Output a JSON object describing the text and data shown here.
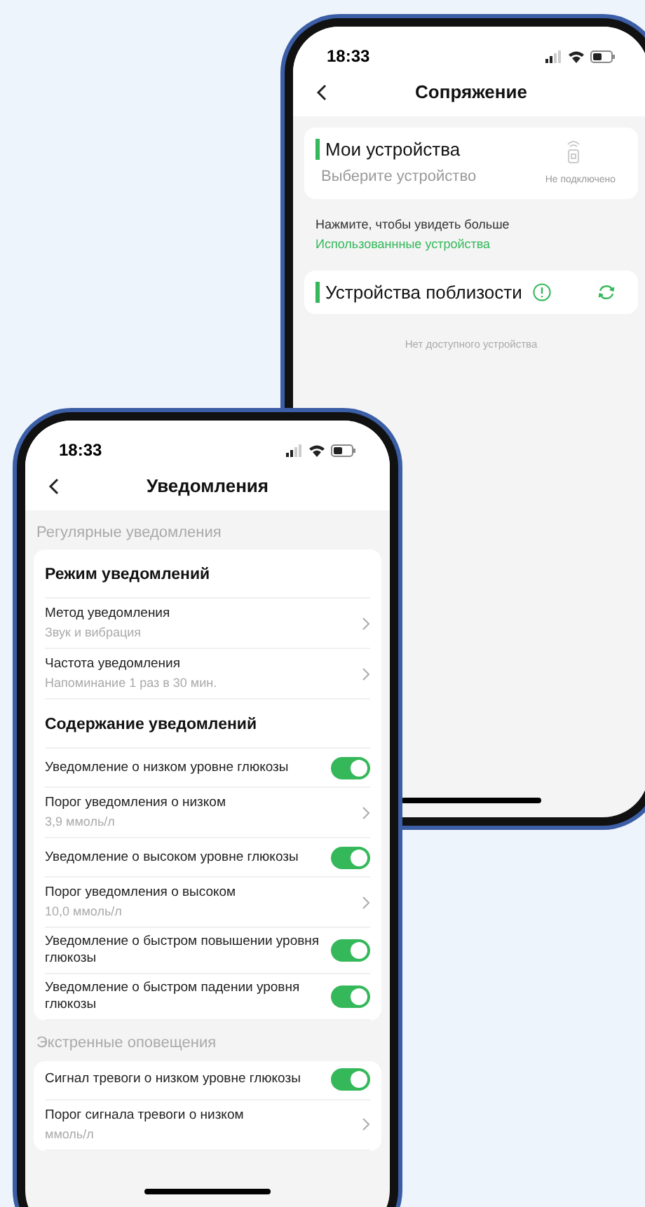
{
  "back_phone": {
    "status_time": "18:33",
    "title": "Сопряжение",
    "my_devices": {
      "title": "Мои устройства",
      "prompt": "Выберите устройство",
      "status": "Не подключено"
    },
    "hint": "Нажмите, чтобы увидеть больше",
    "link": "Использованнные устройства",
    "nearby": {
      "title": "Устройства поблизости"
    },
    "empty": "Нет доступного устройства"
  },
  "front_phone": {
    "status_time": "18:33",
    "title": "Уведомления",
    "sections": [
      {
        "title": "Регулярные уведомления",
        "items": [
          {
            "kind": "heading",
            "label": "Режим уведомлений"
          },
          {
            "kind": "nav",
            "label": "Метод уведомления",
            "value": "Звук и вибрация"
          },
          {
            "kind": "nav",
            "label": "Частота уведомления",
            "value": "Напоминание 1 раз в 30 мин."
          },
          {
            "kind": "heading",
            "label": "Содержание уведомлений"
          },
          {
            "kind": "toggle",
            "label": "Уведомление о низком уровне глюкозы",
            "on": true
          },
          {
            "kind": "nav",
            "label": "Порог уведомления о низком",
            "value": "3,9 ммоль/л"
          },
          {
            "kind": "toggle",
            "label": "Уведомление о высоком уровне глюкозы",
            "on": true
          },
          {
            "kind": "nav",
            "label": "Порог уведомления о высоком",
            "value": "10,0 ммоль/л"
          },
          {
            "kind": "toggle",
            "label": "Уведомление о быстром повышении уровня глюкозы",
            "on": true
          },
          {
            "kind": "toggle",
            "label": "Уведомление о быстром падении уровня глюкозы",
            "on": true
          }
        ]
      },
      {
        "title": "Экстренные оповещения",
        "items": [
          {
            "kind": "toggle",
            "label": "Сигнал тревоги о низком уровне глюкозы",
            "on": true
          },
          {
            "kind": "nav",
            "label": "Порог сигнала тревоги о низком",
            "value": "ммоль/л"
          }
        ]
      }
    ]
  }
}
